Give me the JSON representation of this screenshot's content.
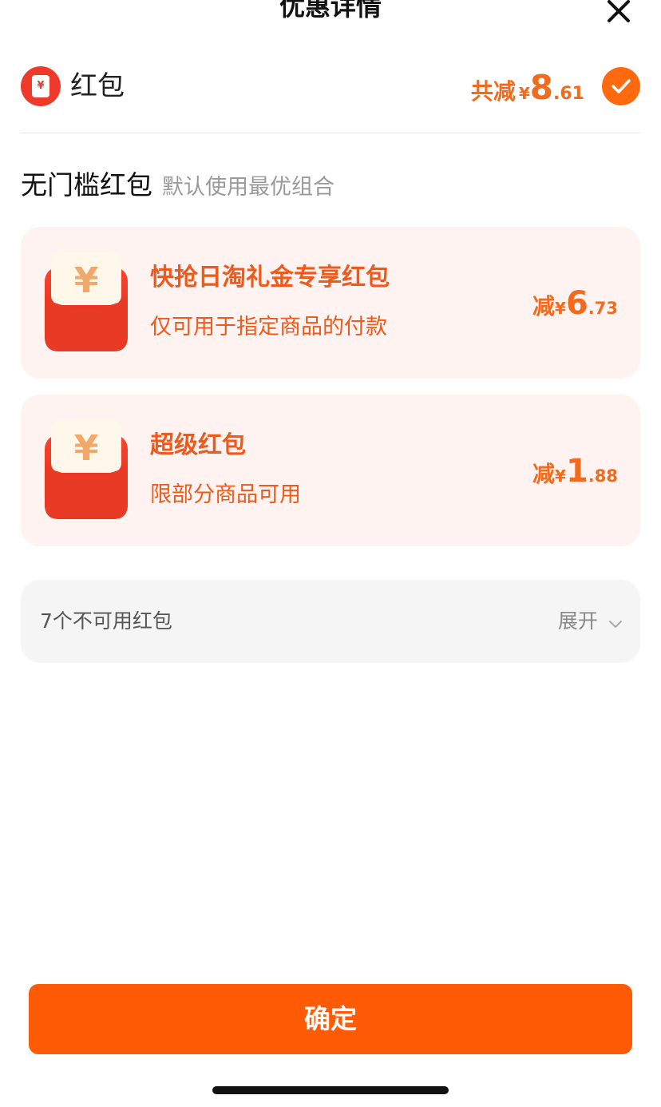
{
  "header": {
    "title": "优惠详情"
  },
  "summary": {
    "title": "红包",
    "badge_symbol": "¥",
    "amount_label": "共减",
    "currency": "¥",
    "amount_int": "8",
    "amount_dec": ".61",
    "selected": true
  },
  "section": {
    "title": "无门槛红包",
    "subtitle": "默认使用最优组合"
  },
  "cards": [
    {
      "title": "快抢日淘礼金专享红包",
      "desc": "仅可用于指定商品的付款",
      "amount_label": "减",
      "currency": "¥",
      "amount_int": "6",
      "amount_dec": ".73"
    },
    {
      "title": "超级红包",
      "desc": "限部分商品可用",
      "amount_label": "减",
      "currency": "¥",
      "amount_int": "1",
      "amount_dec": ".88"
    }
  ],
  "unavailable": {
    "label": "7个不可用红包",
    "toggle_label": "展开"
  },
  "footer": {
    "confirm_label": "确定"
  },
  "colors": {
    "accent": "#ff5a06",
    "amount": "#f26a1b",
    "card_bg": "#fff3f1",
    "envelope_red": "#ef3a2b"
  },
  "icons": {
    "close": "close-icon",
    "check": "check-icon",
    "envelope": "red-envelope-icon",
    "chevron": "chevron-down-icon"
  }
}
